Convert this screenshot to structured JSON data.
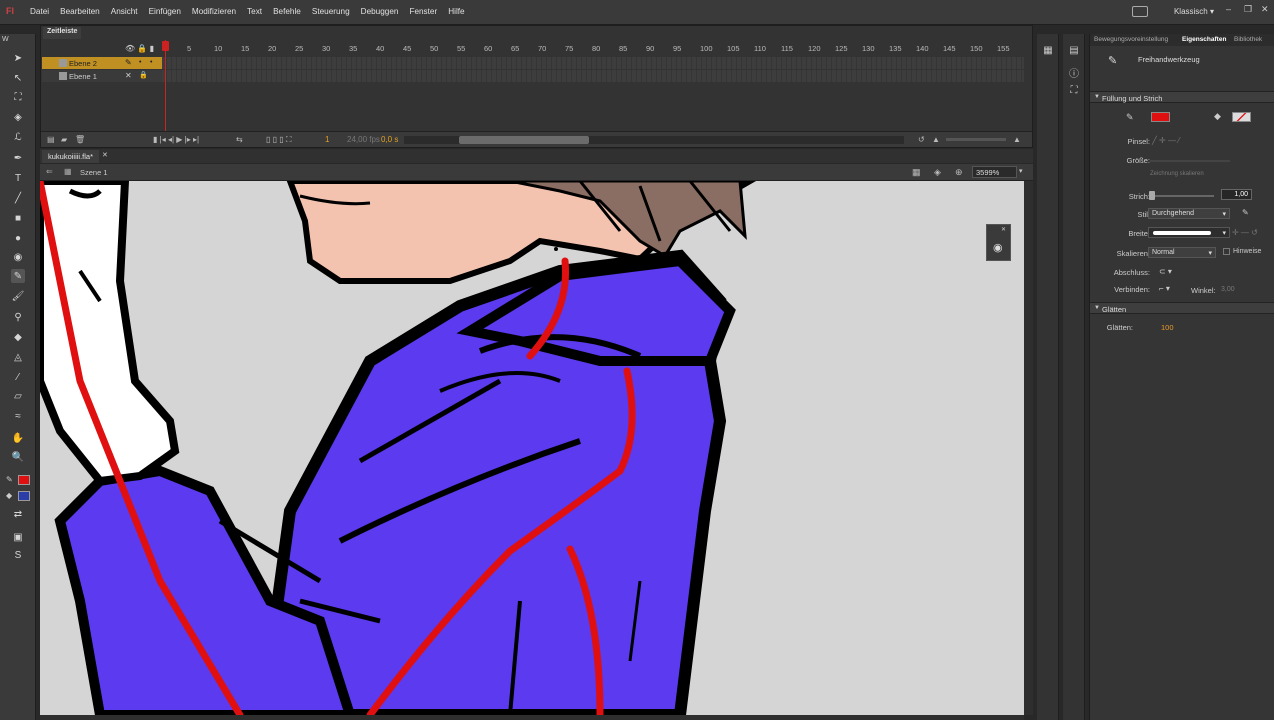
{
  "app": {
    "logo": "Fl",
    "menu": [
      "Datei",
      "Bearbeiten",
      "Ansicht",
      "Einfügen",
      "Modifizieren",
      "Text",
      "Befehle",
      "Steuerung",
      "Debuggen",
      "Fenster",
      "Hilfe"
    ],
    "workspace": "Klassisch",
    "window_buttons": [
      "–",
      "❐",
      "✕"
    ]
  },
  "toolbar": {
    "header": "W"
  },
  "timeline": {
    "tab": "Zeitleiste",
    "frame_numbers": [
      "1",
      "5",
      "10",
      "15",
      "20",
      "25",
      "30",
      "35",
      "40",
      "45",
      "50",
      "55",
      "60",
      "65",
      "70",
      "75",
      "80",
      "85",
      "90",
      "95",
      "100",
      "105",
      "110",
      "115",
      "120",
      "125",
      "130",
      "135",
      "140",
      "145",
      "150",
      "155"
    ],
    "layers": [
      {
        "name": "Ebene 2",
        "active": true
      },
      {
        "name": "Ebene 1",
        "active": false
      }
    ],
    "current_frame": "1",
    "fps": "24,00 fps",
    "time": "0,0 s"
  },
  "document": {
    "tab": "kukukoiiiii.fla*",
    "scene": "Szene 1",
    "zoom": "3599%"
  },
  "properties": {
    "tabs": [
      "Bewegungsvoreinstellung",
      "Eigenschaften",
      "Bibliothek"
    ],
    "active_tab": "Eigenschaften",
    "tool_name": "Freihandwerkzeug",
    "section_fill_stroke": "Füllung und Strich",
    "stroke_color": "#e01010",
    "fill_color": "#c8c8c8",
    "labels": {
      "pinsel": "Pinsel:",
      "groesse": "Größe:",
      "strich": "Strich:",
      "stil": "Stil:",
      "breite": "Breite:",
      "skalieren": "Skalieren:",
      "abschluss": "Abschluss:",
      "verbinden": "Verbinden:",
      "winkel": "Winkel:",
      "hinweise": "Hinweise",
      "glaetten_label": "Glätten:",
      "brush_hint": "Zeichnung skalieren"
    },
    "stroke_value": "1,00",
    "style_value": "Durchgehend",
    "scale_value": "Normal",
    "angle_value": "3,00",
    "section_smoothing": "Glätten",
    "smoothing_value": "100"
  }
}
